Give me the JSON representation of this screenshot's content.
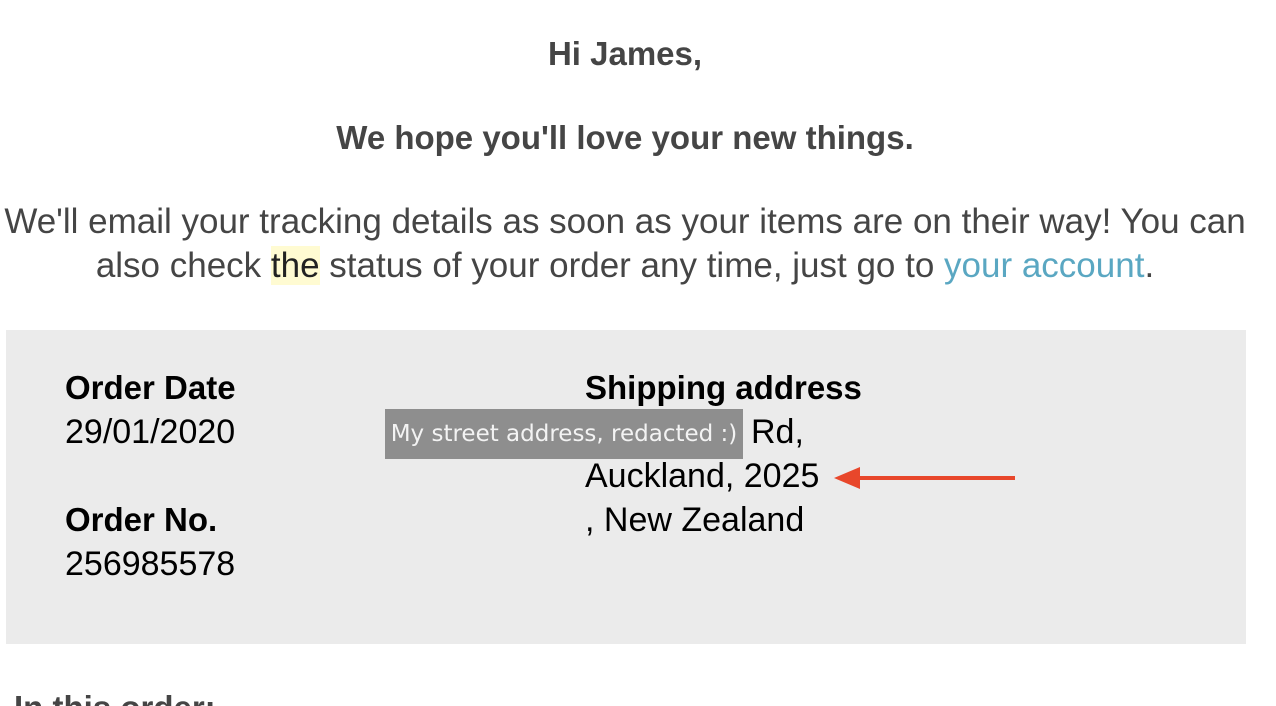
{
  "header": {
    "greeting": "Hi James,",
    "tagline": "We hope you'll love your new things."
  },
  "message": {
    "part1": "We'll email your tracking details as soon as your items are on their way! You can also check ",
    "highlighted": "the",
    "part2": " status of your order any time, just go to ",
    "link_text": "your account",
    "part3": "."
  },
  "order": {
    "date_label": "Order Date",
    "date_value": "29/01/2020",
    "number_label": "Order No.",
    "number_value": "256985578"
  },
  "shipping": {
    "label": "Shipping address",
    "line1": "Rd,",
    "line2": "Auckland, 2025",
    "line3": ", New Zealand",
    "redaction_note": "My street address, redacted :)"
  },
  "annotation": {
    "arrow_color": "#e8472b"
  },
  "next_section": {
    "heading": "In this order:"
  },
  "colors": {
    "text": "#454545",
    "link": "#5aa7c2",
    "highlight": "#fffbd2",
    "box_background": "#ebebeb"
  }
}
